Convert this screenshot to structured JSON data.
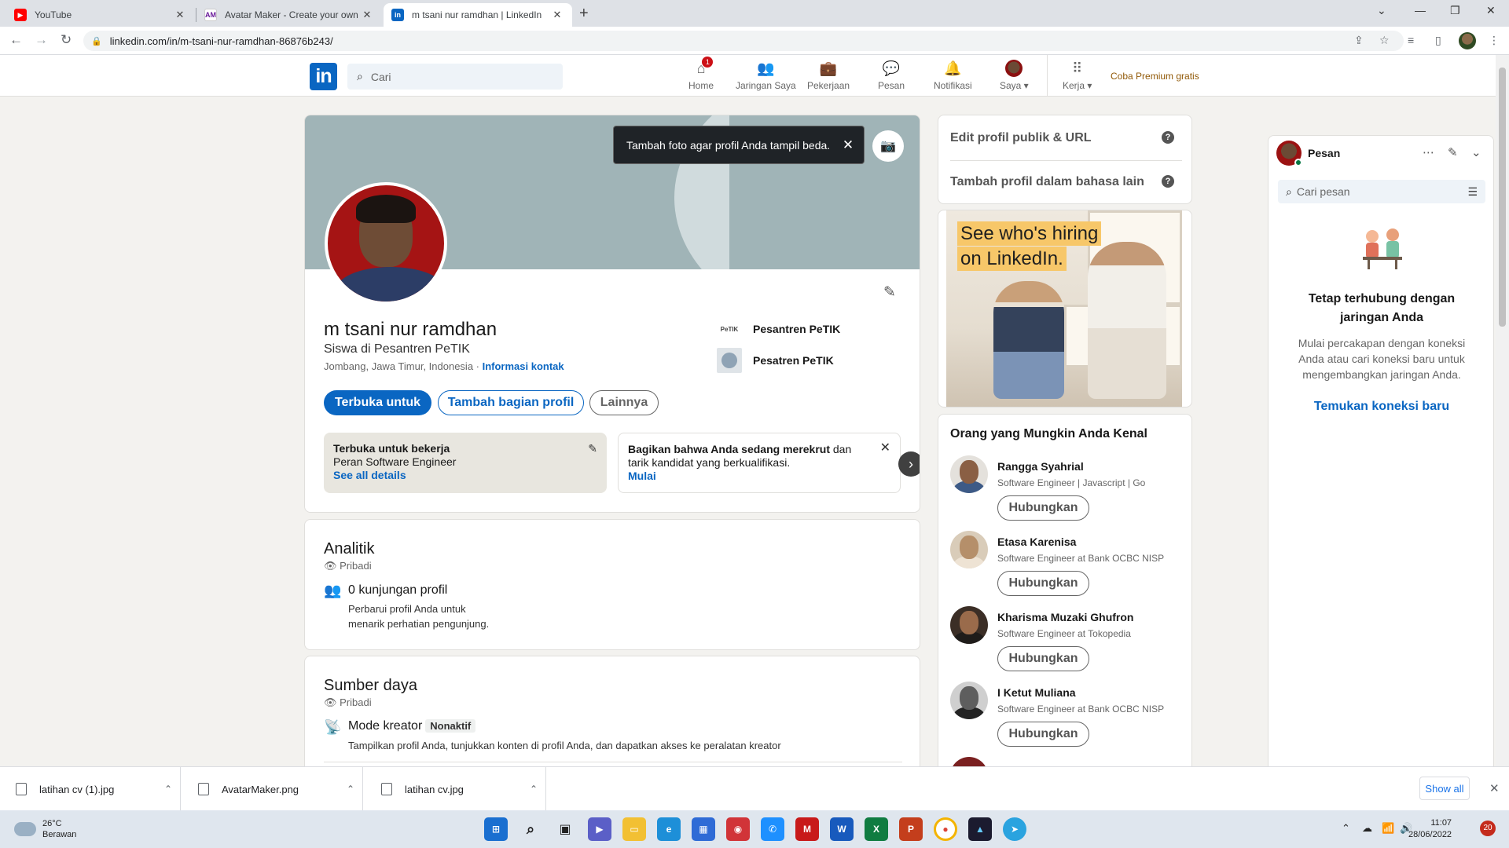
{
  "browser": {
    "tabs": [
      {
        "title": "YouTube",
        "favicon": "youtube-icon"
      },
      {
        "title": "Avatar Maker - Create your own a",
        "favicon": "avatarmaker-icon"
      },
      {
        "title": "m tsani nur ramdhan | LinkedIn",
        "favicon": "linkedin-icon"
      }
    ],
    "url": "linkedin.com/in/m-tsani-nur-ramdhan-86876b243/"
  },
  "linkedin": {
    "logo": "in",
    "search_placeholder": "Cari",
    "nav": [
      {
        "label": "Home",
        "icon": "home-icon",
        "badge": "1"
      },
      {
        "label": "Jaringan Saya",
        "icon": "network-icon"
      },
      {
        "label": "Pekerjaan",
        "icon": "briefcase-icon"
      },
      {
        "label": "Pesan",
        "icon": "message-icon"
      },
      {
        "label": "Notifikasi",
        "icon": "bell-icon"
      },
      {
        "label": "Saya ▾",
        "icon": "avatar"
      },
      {
        "label": "Kerja ▾",
        "icon": "grid-icon"
      }
    ],
    "premium": "Coba Premium gratis"
  },
  "profile": {
    "tooltip": "Tambah foto agar profil Anda tampil beda.",
    "name": "m tsani nur ramdhan",
    "headline": "Siswa di Pesantren PeTIK",
    "location": "Jombang, Jawa Timur, Indonesia · ",
    "contact_link": "Informasi kontak",
    "orgs": [
      {
        "name": "Pesantren PeTIK",
        "logo_text": "PeTIK"
      },
      {
        "name": "Pesatren PeTIK",
        "logo_text": ""
      }
    ],
    "buttons": {
      "open_to": "Terbuka untuk",
      "add_section": "Tambah bagian profil",
      "more": "Lainnya"
    },
    "open_to_work": {
      "title": "Terbuka untuk bekerja",
      "role": "Peran Software Engineer",
      "details_link": "See all details"
    },
    "recruit": {
      "text_bold": "Bagikan bahwa Anda sedang merekrut",
      "text_rest": " dan tarik kandidat yang berkualifikasi.",
      "link": "Mulai"
    }
  },
  "analytics": {
    "title": "Analitik",
    "privacy": "Pribadi",
    "views_title": "0 kunjungan profil",
    "views_desc_1": "Perbarui profil Anda untuk",
    "views_desc_2": "menarik perhatian pengunjung."
  },
  "resources": {
    "title": "Sumber daya",
    "privacy": "Pribadi",
    "creator_title": "Mode kreator",
    "creator_badge": "Nonaktif",
    "creator_desc": "Tampilkan profil Anda, tunjukkan konten di profil Anda, dan dapatkan akses ke peralatan kreator"
  },
  "sidebar": {
    "links": [
      "Edit profil publik & URL",
      "Tambah profil dalam bahasa lain"
    ],
    "ad_line1": "See who's hiring",
    "ad_line2": "on LinkedIn.",
    "pymk_title": "Orang yang Mungkin Anda Kenal",
    "connect_label": "Hubungkan",
    "people": [
      {
        "name": "Rangga Syahrial",
        "headline": "Software Engineer | Javascript | Go"
      },
      {
        "name": "Etasa Karenisa",
        "headline": "Software Engineer at Bank OCBC NISP"
      },
      {
        "name": "Kharisma Muzaki Ghufron",
        "headline": "Software Engineer at Tokopedia"
      },
      {
        "name": "I Ketut Muliana",
        "headline": "Software Engineer at Bank OCBC NISP"
      }
    ]
  },
  "messaging": {
    "title": "Pesan",
    "search_placeholder": "Cari pesan",
    "heading": "Tetap terhubung dengan jaringan Anda",
    "desc": "Mulai percakapan dengan koneksi Anda atau cari koneksi baru untuk mengembangkan jaringan Anda.",
    "link": "Temukan koneksi baru"
  },
  "downloads": {
    "files": [
      "latihan cv (1).jpg",
      "AvatarMaker.png",
      "latihan cv.jpg"
    ],
    "show_all": "Show all"
  },
  "taskbar": {
    "temp": "26°C",
    "weather": "Berawan",
    "time": "11:07",
    "date": "28/06/2022",
    "notifications": "20"
  }
}
